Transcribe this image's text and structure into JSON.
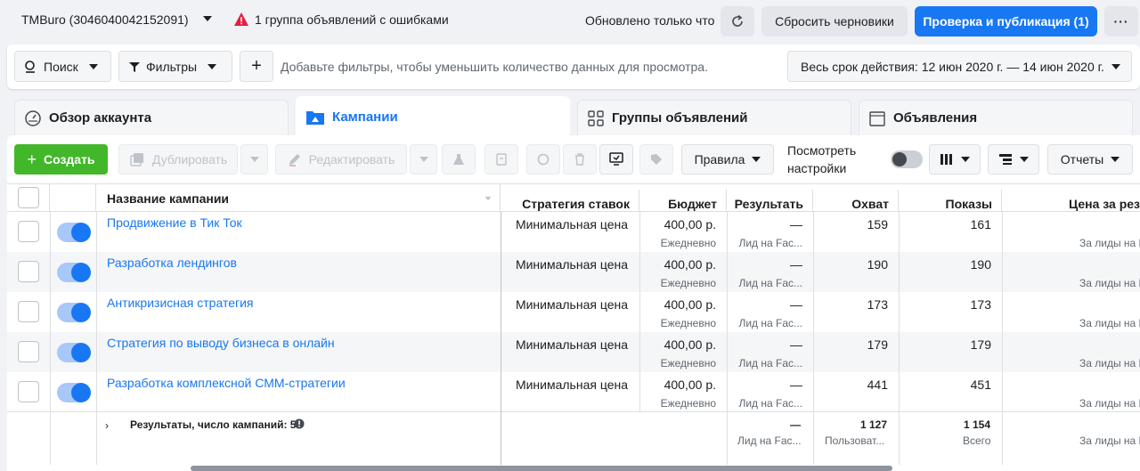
{
  "topbar": {
    "account": "TMBuro (3046040042152091)",
    "warning": "1 группа объявлений с ошибками",
    "updated": "Обновлено только что",
    "discard": "Сбросить черновики",
    "publish": "Проверка и публикация (1)",
    "more": "···"
  },
  "filterbar": {
    "search": "Поиск",
    "filters": "Фильтры",
    "add": "+",
    "hint": "Добавьте фильтры, чтобы уменьшить количество данных для просмотра.",
    "date_range": "Весь срок действия: 12 июн 2020 г. — 14 июн 2020 г."
  },
  "tabs": [
    {
      "label": "Обзор аккаунта"
    },
    {
      "label": "Кампании"
    },
    {
      "label": "Группы объявлений"
    },
    {
      "label": "Объявления"
    }
  ],
  "toolbar": {
    "create": "Создать",
    "duplicate": "Дублировать",
    "edit": "Редактировать",
    "rules": "Правила",
    "view_settings_1": "Посмотреть",
    "view_settings_2": "настройки",
    "reports": "Отчеты"
  },
  "columns": {
    "name": "Название кампании",
    "strategy": "Стратегия ставок",
    "budget": "Бюджет",
    "result": "Результать",
    "reach": "Охват",
    "impressions": "Показы",
    "cost": "Цена за рез"
  },
  "rows": [
    {
      "name": "Продвижение в Тик Ток",
      "strategy": "Минимальная цена",
      "budget": "400,00 р.",
      "budget_sub": "Ежедневно",
      "result": "—",
      "result_sub": "Лид на Fac...",
      "reach": "159",
      "impressions": "161",
      "cost_sub": "За лиды на F"
    },
    {
      "name": "Разработка лендингов",
      "strategy": "Минимальная цена",
      "budget": "400,00 р.",
      "budget_sub": "Ежедневно",
      "result": "—",
      "result_sub": "Лид на Fac...",
      "reach": "190",
      "impressions": "190",
      "cost_sub": "За лиды на F"
    },
    {
      "name": "Антикризисная стратегия",
      "strategy": "Минимальная цена",
      "budget": "400,00 р.",
      "budget_sub": "Ежедневно",
      "result": "—",
      "result_sub": "Лид на Fac...",
      "reach": "173",
      "impressions": "173",
      "cost_sub": "За лиды на F"
    },
    {
      "name": "Стратегия по выводу бизнеса в онлайн",
      "strategy": "Минимальная цена",
      "budget": "400,00 р.",
      "budget_sub": "Ежедневно",
      "result": "—",
      "result_sub": "Лид на Fac...",
      "reach": "179",
      "impressions": "179",
      "cost_sub": "За лиды на F"
    },
    {
      "name": "Разработка комплексной СММ-стратегии",
      "strategy": "Минимальная цена",
      "budget": "400,00 р.",
      "budget_sub": "Ежедневно",
      "result": "—",
      "result_sub": "Лид на Fac...",
      "reach": "441",
      "impressions": "451",
      "cost_sub": "За лиды на F"
    }
  ],
  "summary": {
    "label": "Результаты, число кампаний: 5",
    "result": "—",
    "result_sub": "Лид на Fac...",
    "reach": "1 127",
    "reach_sub": "Пользоват...",
    "impressions": "1 154",
    "impressions_sub": "Всего",
    "cost_sub": "За лиды на F"
  },
  "colors": {
    "accent": "#1877f2",
    "create": "#42b72a",
    "warning": "#e41e3f"
  }
}
